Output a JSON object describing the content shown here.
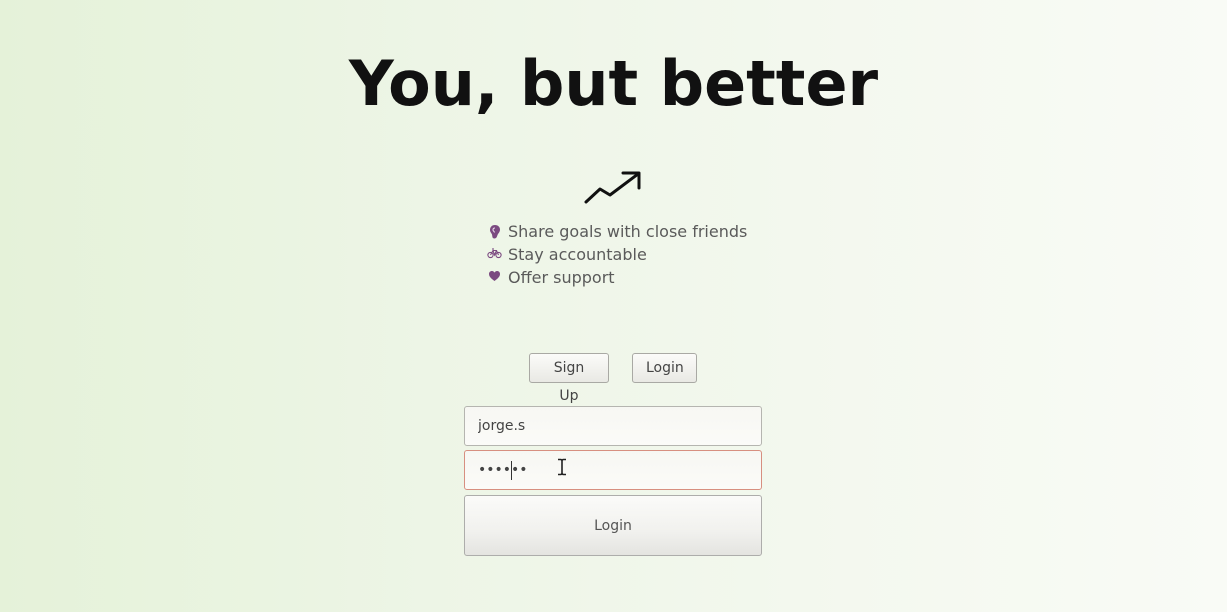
{
  "hero": {
    "title": "You, but better",
    "icon": "trending-up-icon"
  },
  "features": [
    {
      "icon": "ear-icon",
      "label": "Share goals with close friends"
    },
    {
      "icon": "bicycle-icon",
      "label": "Stay accountable"
    },
    {
      "icon": "heart-icon",
      "label": "Offer support"
    }
  ],
  "tabs": {
    "signup_label": "Sign Up",
    "login_label": "Login"
  },
  "form": {
    "username_value": "jorge.s",
    "password_value": "••••••",
    "submit_label": "Login"
  },
  "colors": {
    "accent_icon": "#7b4a80",
    "password_focus_border": "#d78f80"
  }
}
